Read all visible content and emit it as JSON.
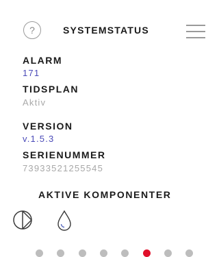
{
  "header": {
    "help_glyph": "?",
    "title": "SYSTEMSTATUS"
  },
  "status": {
    "alarm_label": "ALARM",
    "alarm_value": "171",
    "schedule_label": "TIDSPLAN",
    "schedule_value": "Aktiv",
    "version_label": "VERSION",
    "version_value": "v.1.5.3",
    "serial_label": "SERIENUMMER",
    "serial_value": "73933521255545"
  },
  "components": {
    "heading": "AKTIVE KOMPONENTER",
    "icons": [
      "circulation-pump-icon",
      "water-drop-icon"
    ]
  },
  "pagination": {
    "page_count": 8,
    "active_page": 6
  },
  "colors": {
    "link_blue": "#4a4ab8",
    "muted_gray": "#a8a8a8",
    "dot_inactive": "#bdbdbd",
    "dot_active": "#e0102a",
    "icon_blue": "#5a6cc0"
  }
}
